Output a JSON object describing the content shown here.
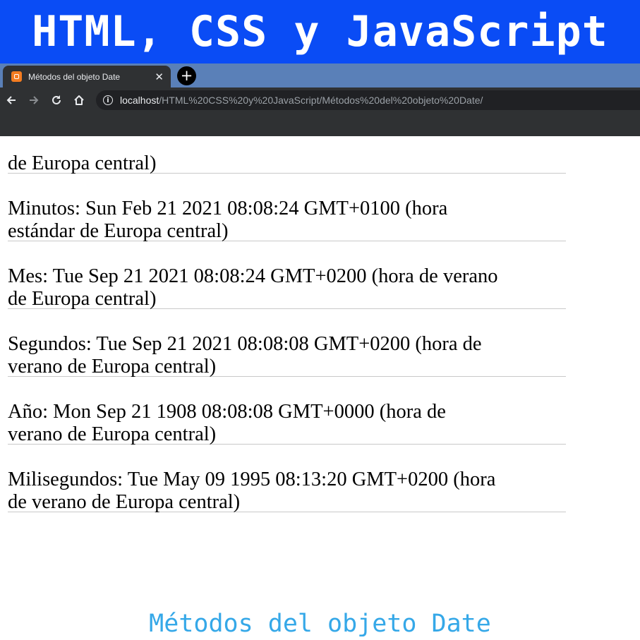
{
  "banner": {
    "title": "HTML, CSS y JavaScript"
  },
  "browser": {
    "tab_title": "Métodos del objeto Date",
    "tab_close": "✕",
    "new_tab": "+",
    "url_host": "localhost",
    "url_path": "/HTML%20CSS%20y%20JavaScript/Métodos%20del%20objeto%20Date/",
    "icons": [
      "back-arrow-icon",
      "forward-arrow-icon",
      "reload-icon",
      "home-icon",
      "info-icon",
      "tab-favicon-icon"
    ]
  },
  "entries": [
    {
      "line1": "",
      "line2": "de Europa central)"
    },
    {
      "line1": "Minutos: Sun Feb 21 2021 08:08:24 GMT+0100 (hora",
      "line2": "estándar de Europa central)"
    },
    {
      "line1": "Mes: Tue Sep 21 2021 08:08:24 GMT+0200 (hora de verano",
      "line2": "de Europa central)"
    },
    {
      "line1": "Segundos: Tue Sep 21 2021 08:08:08 GMT+0200 (hora de",
      "line2": "verano de Europa central)"
    },
    {
      "line1": "Año: Mon Sep 21 1908 08:08:08 GMT+0000 (hora de",
      "line2": "verano de Europa central)"
    },
    {
      "line1": "Milisegundos: Tue May 09 1995 08:13:20 GMT+0200 (hora",
      "line2": "de verano de Europa central)"
    }
  ],
  "caption": "Métodos del objeto Date",
  "colors": {
    "banner": "#0a4cf5",
    "tabbar": "#5a80b8",
    "chrome": "#2f3133",
    "caption": "#35a8e8"
  }
}
